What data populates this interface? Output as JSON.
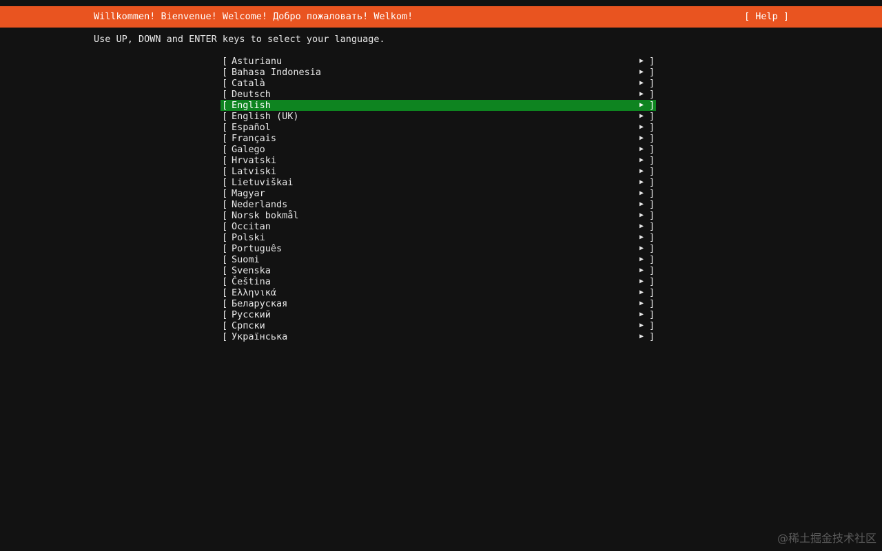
{
  "header": {
    "title": "Willkommen! Bienvenue! Welcome! Добро пожаловать! Welkom!",
    "help_label": "[ Help ]"
  },
  "instructions": "Use UP, DOWN and ENTER keys to select your language.",
  "languages": {
    "selected": "English",
    "bracket_open": "[",
    "bracket_close": "]",
    "arrow_icon": "▶",
    "items": [
      {
        "label": "Asturianu"
      },
      {
        "label": "Bahasa Indonesia"
      },
      {
        "label": "Català"
      },
      {
        "label": "Deutsch"
      },
      {
        "label": "English"
      },
      {
        "label": "English (UK)"
      },
      {
        "label": "Español"
      },
      {
        "label": "Français"
      },
      {
        "label": "Galego"
      },
      {
        "label": "Hrvatski"
      },
      {
        "label": "Latviski"
      },
      {
        "label": "Lietuviškai"
      },
      {
        "label": "Magyar"
      },
      {
        "label": "Nederlands"
      },
      {
        "label": "Norsk bokmål"
      },
      {
        "label": "Occitan"
      },
      {
        "label": "Polski"
      },
      {
        "label": "Português"
      },
      {
        "label": "Suomi"
      },
      {
        "label": "Svenska"
      },
      {
        "label": "Čeština"
      },
      {
        "label": "Ελληνικά"
      },
      {
        "label": "Беларуская"
      },
      {
        "label": "Русский"
      },
      {
        "label": "Српски"
      },
      {
        "label": "Українська"
      }
    ]
  },
  "watermark": "@稀土掘金技术社区",
  "colors": {
    "header_bg": "#e95420",
    "selected_bg": "#0e8420",
    "background": "#121212"
  }
}
